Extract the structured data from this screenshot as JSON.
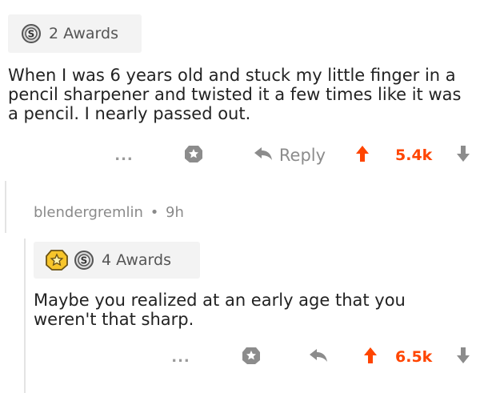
{
  "comment1": {
    "awards_label": "2 Awards",
    "body": "When I was 6 years old and stuck my little finger in a pencil sharpener and twisted it a few times like it was a pencil. I nearly passed out.",
    "actions": {
      "more": "...",
      "reply_label": "Reply",
      "score": "5.4k"
    }
  },
  "comment2": {
    "author": "blendergremlin",
    "separator": "•",
    "age": "9h",
    "awards_label": "4 Awards",
    "body": "Maybe you realized at an early age that you weren't that sharp.",
    "actions": {
      "more": "...",
      "score": "6.5k"
    }
  },
  "colors": {
    "upvote": "#ff4500",
    "muted": "#8c8c8c",
    "thread_line": "#e4e4e4",
    "award_bg": "#f3f3f3"
  },
  "icons": [
    "silver-award-icon",
    "gold-award-icon",
    "more-icon",
    "award-icon",
    "reply-icon",
    "upvote-icon",
    "downvote-icon"
  ]
}
